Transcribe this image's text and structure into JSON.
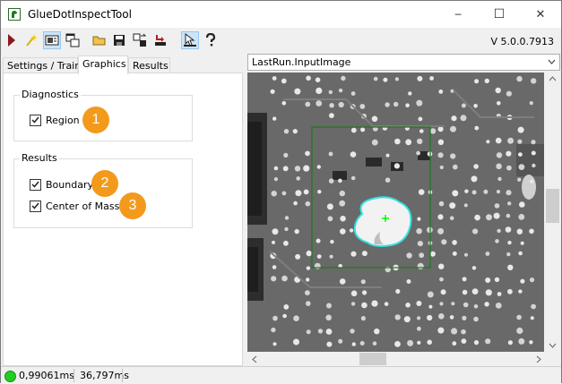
{
  "window": {
    "title": "GlueDotInspectTool",
    "minimize_glyph": "─",
    "maximize_glyph": "☐",
    "close_glyph": "✕"
  },
  "toolbar": {
    "version": "V 5.0.0.7913",
    "buttons": [
      "run-icon",
      "wand-icon",
      "display-icon",
      "windows-icon",
      "open-folder-icon",
      "save-icon",
      "export-icon",
      "import-icon",
      "graphics-toggle-icon",
      "help-icon"
    ]
  },
  "tabs": [
    {
      "label": "Settings / Train"
    },
    {
      "label": "Graphics"
    },
    {
      "label": "Results"
    }
  ],
  "diagnostics": {
    "legend": "Diagnostics",
    "region": {
      "label": "Region",
      "checked": true,
      "badge": "1"
    }
  },
  "results": {
    "legend": "Results",
    "boundary": {
      "label": "Boundary",
      "checked": true,
      "badge": "2"
    },
    "center_of_mass": {
      "label": "Center of Mass",
      "checked": true,
      "badge": "3"
    }
  },
  "image_selector": {
    "value": "LastRun.InputImage"
  },
  "status": {
    "time1": "0,99061ms",
    "time2": "36,797ms"
  },
  "colors": {
    "badge": "#f39a1c",
    "region_box": "#1a7a1a",
    "boundary": "#33e0e0",
    "center_mark": "#00ff00",
    "status_ok": "#22cc22"
  }
}
